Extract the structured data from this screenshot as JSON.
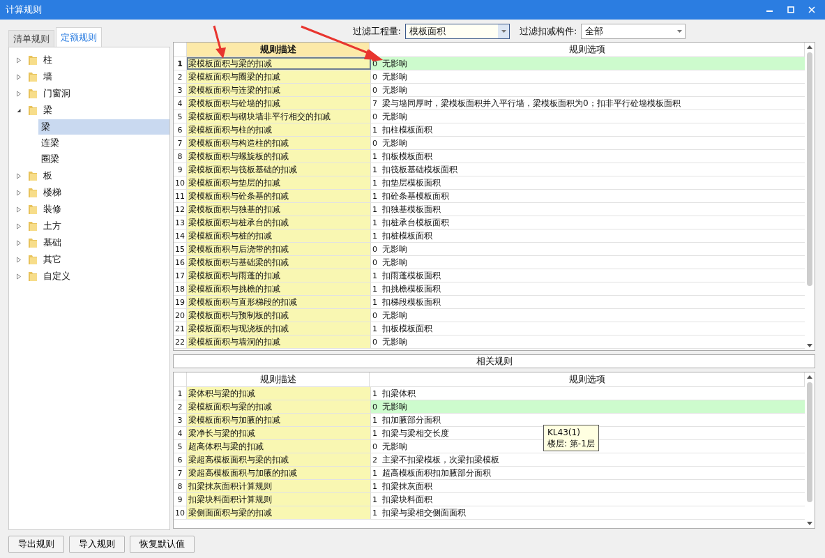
{
  "window": {
    "title": "计算规则"
  },
  "tabs": [
    {
      "label": "清单规则",
      "selected": false
    },
    {
      "label": "定额规则",
      "selected": true
    }
  ],
  "tree": [
    {
      "label": "柱",
      "expanded": false,
      "selected": false
    },
    {
      "label": "墙",
      "expanded": false,
      "selected": false
    },
    {
      "label": "门窗洞",
      "expanded": false,
      "selected": false
    },
    {
      "label": "梁",
      "expanded": true,
      "selected": false,
      "children": [
        {
          "label": "梁",
          "selected": true
        },
        {
          "label": "连梁",
          "selected": false
        },
        {
          "label": "圈梁",
          "selected": false
        }
      ]
    },
    {
      "label": "板",
      "expanded": false,
      "selected": false
    },
    {
      "label": "楼梯",
      "expanded": false,
      "selected": false
    },
    {
      "label": "装修",
      "expanded": false,
      "selected": false
    },
    {
      "label": "土方",
      "expanded": false,
      "selected": false
    },
    {
      "label": "基础",
      "expanded": false,
      "selected": false
    },
    {
      "label": "其它",
      "expanded": false,
      "selected": false
    },
    {
      "label": "自定义",
      "expanded": false,
      "selected": false
    }
  ],
  "filters": [
    {
      "label": "过滤工程量:",
      "value": "模板面积",
      "focused": true
    },
    {
      "label": "过滤扣减构件:",
      "value": "全部",
      "focused": false
    }
  ],
  "rules_table": {
    "columns": [
      {
        "label": "规则描述",
        "active": true
      },
      {
        "label": "规则选项",
        "active": false
      }
    ],
    "rows": [
      {
        "no": "1",
        "description": "梁模板面积与梁的扣减",
        "code": "0",
        "option": "无影响",
        "selected": true
      },
      {
        "no": "2",
        "description": "梁模板面积与圈梁的扣减",
        "code": "0",
        "option": "无影响",
        "selected": false
      },
      {
        "no": "3",
        "description": "梁模板面积与连梁的扣减",
        "code": "0",
        "option": "无影响",
        "selected": false
      },
      {
        "no": "4",
        "description": "梁模板面积与砼墙的扣减",
        "code": "7",
        "option": "梁与墙同厚时，梁模板面积并入平行墙，梁模板面积为0；扣非平行砼墙模板面积",
        "selected": false
      },
      {
        "no": "5",
        "description": "梁模板面积与砌块墙非平行相交的扣减",
        "code": "0",
        "option": "无影响",
        "selected": false
      },
      {
        "no": "6",
        "description": "梁模板面积与柱的扣减",
        "code": "1",
        "option": "扣柱模板面积",
        "selected": false
      },
      {
        "no": "7",
        "description": "梁模板面积与构造柱的扣减",
        "code": "0",
        "option": "无影响",
        "selected": false
      },
      {
        "no": "8",
        "description": "梁模板面积与螺旋板的扣减",
        "code": "1",
        "option": "扣板模板面积",
        "selected": false
      },
      {
        "no": "9",
        "description": "梁模板面积与筏板基础的扣减",
        "code": "1",
        "option": "扣筏板基础模板面积",
        "selected": false
      },
      {
        "no": "10",
        "description": "梁模板面积与垫层的扣减",
        "code": "1",
        "option": "扣垫层模板面积",
        "selected": false
      },
      {
        "no": "11",
        "description": "梁模板面积与砼条基的扣减",
        "code": "1",
        "option": "扣砼条基模板面积",
        "selected": false
      },
      {
        "no": "12",
        "description": "梁模板面积与独基的扣减",
        "code": "1",
        "option": "扣独基模板面积",
        "selected": false
      },
      {
        "no": "13",
        "description": "梁模板面积与桩承台的扣减",
        "code": "1",
        "option": "扣桩承台模板面积",
        "selected": false
      },
      {
        "no": "14",
        "description": "梁模板面积与桩的扣减",
        "code": "1",
        "option": "扣桩模板面积",
        "selected": false
      },
      {
        "no": "15",
        "description": "梁模板面积与后浇带的扣减",
        "code": "0",
        "option": "无影响",
        "selected": false
      },
      {
        "no": "16",
        "description": "梁模板面积与基础梁的扣减",
        "code": "0",
        "option": "无影响",
        "selected": false
      },
      {
        "no": "17",
        "description": "梁模板面积与雨蓬的扣减",
        "code": "1",
        "option": "扣雨蓬模板面积",
        "selected": false
      },
      {
        "no": "18",
        "description": "梁模板面积与挑檐的扣减",
        "code": "1",
        "option": "扣挑檐模板面积",
        "selected": false
      },
      {
        "no": "19",
        "description": "梁模板面积与直形梯段的扣减",
        "code": "1",
        "option": "扣梯段模板面积",
        "selected": false
      },
      {
        "no": "20",
        "description": "梁模板面积与预制板的扣减",
        "code": "0",
        "option": "无影响",
        "selected": false
      },
      {
        "no": "21",
        "description": "梁模板面积与现浇板的扣减",
        "code": "1",
        "option": "扣板模板面积",
        "selected": false
      },
      {
        "no": "22",
        "description": "梁模板面积与墙洞的扣减",
        "code": "0",
        "option": "无影响",
        "selected": false
      }
    ]
  },
  "related_label": "相关规则",
  "related_table": {
    "columns": [
      {
        "label": "规则描述",
        "active": false
      },
      {
        "label": "规则选项",
        "active": false
      }
    ],
    "rows": [
      {
        "no": "1",
        "description": "梁体积与梁的扣减",
        "code": "1",
        "option": "扣梁体积",
        "selected": false
      },
      {
        "no": "2",
        "description": "梁模板面积与梁的扣减",
        "code": "0",
        "option": "无影响",
        "selected": true
      },
      {
        "no": "3",
        "description": "梁模板面积与加腋的扣减",
        "code": "1",
        "option": "扣加腋部分面积",
        "selected": false
      },
      {
        "no": "4",
        "description": "梁净长与梁的扣减",
        "code": "1",
        "option": "扣梁与梁相交长度",
        "selected": false
      },
      {
        "no": "5",
        "description": "超高体积与梁的扣减",
        "code": "0",
        "option": "无影响",
        "selected": false
      },
      {
        "no": "6",
        "description": "梁超高模板面积与梁的扣减",
        "code": "2",
        "option": "主梁不扣梁模板，次梁扣梁模板",
        "selected": false
      },
      {
        "no": "7",
        "description": "梁超高模板面积与加腋的扣减",
        "code": "1",
        "option": "超高模板面积扣加腋部分面积",
        "selected": false
      },
      {
        "no": "8",
        "description": "扣梁抹灰面积计算规则",
        "code": "1",
        "option": "扣梁抹灰面积",
        "selected": false
      },
      {
        "no": "9",
        "description": "扣梁块料面积计算规则",
        "code": "1",
        "option": "扣梁块料面积",
        "selected": false
      },
      {
        "no": "10",
        "description": "梁侧面面积与梁的扣减",
        "code": "1",
        "option": "扣梁与梁相交侧面面积",
        "selected": false
      }
    ]
  },
  "tooltip": {
    "title": "KL43(1)",
    "text": "楼层: 第-1层"
  },
  "buttons": [
    "导出规则",
    "导入规则",
    "恢复默认值"
  ]
}
